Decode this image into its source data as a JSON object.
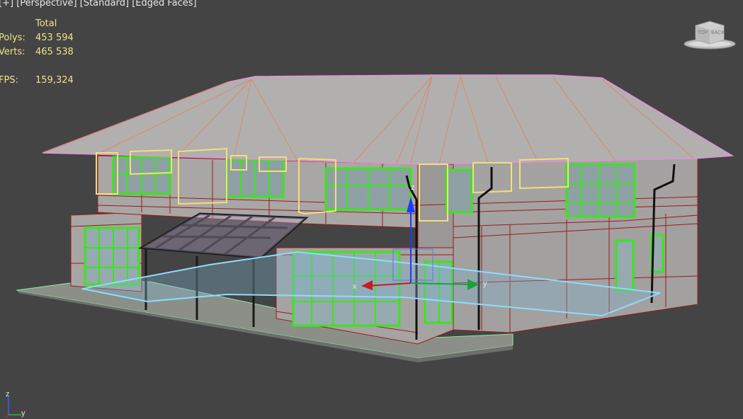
{
  "viewport": {
    "menu": {
      "plus": "[+]",
      "view": "[Perspective]",
      "shading": "[Standard]",
      "style": "[Edged Faces]"
    },
    "stats": {
      "header": "Total",
      "polys_label": "Polys:",
      "polys_value": "453 594",
      "verts_label": "Verts:",
      "verts_value": "465 538",
      "fps_label": "FPS:",
      "fps_value": "159,324"
    },
    "viewcube": {
      "face_left": "TOP",
      "face_right": "BACK"
    },
    "gizmo": {
      "x_label": "x",
      "y_label": "y",
      "z_label": "z"
    },
    "tripod": {
      "z_label": "z",
      "y_label": "y"
    }
  },
  "colors": {
    "background": "#444444",
    "wire_red": "#9a1a1a",
    "window_green": "#39e61e",
    "selection_yellow": "#f1e07a",
    "roof_edge": "#e88fdb",
    "slab_cyan": "#8fdcff",
    "stats_text": "#f0e28a"
  },
  "icons": [
    "viewcube-icon",
    "transform-gizmo-icon",
    "axis-tripod-icon"
  ]
}
